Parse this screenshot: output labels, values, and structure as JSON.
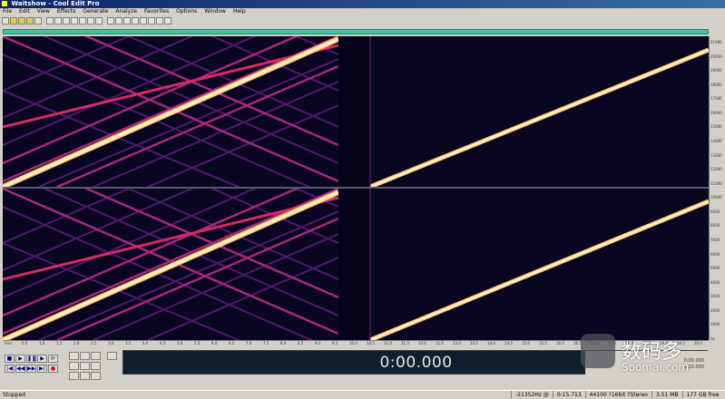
{
  "window": {
    "title": "Waitshow - Cool Edit Pro"
  },
  "menu": {
    "items": [
      "File",
      "Edit",
      "View",
      "Effects",
      "Generate",
      "Analyze",
      "Favorites",
      "Options",
      "Window",
      "Help"
    ]
  },
  "overview_color": "#47c0a0",
  "spectral_colors": {
    "background": "#080620",
    "hot": "#fff2c8",
    "mid": "#d42a64",
    "dim": "#5a1a7a"
  },
  "right_ruler": {
    "ticks": [
      "21000",
      "20000",
      "19000",
      "18000",
      "17000",
      "16000",
      "15000",
      "14000",
      "13000",
      "12000",
      "11000",
      "10000",
      "9000",
      "8000",
      "7000",
      "6000",
      "5000",
      "4000",
      "3000",
      "2000",
      "1000",
      "hz"
    ]
  },
  "bottom_ruler": {
    "ticks": [
      "hms",
      "0.5",
      "1.0",
      "1.5",
      "2.0",
      "2.5",
      "3.0",
      "3.5",
      "4.0",
      "4.5",
      "5.0",
      "5.5",
      "6.0",
      "6.5",
      "7.0",
      "7.5",
      "8.0",
      "8.5",
      "9.0",
      "9.5",
      "10.0",
      "10.5",
      "11.0",
      "11.5",
      "12.0",
      "12.5",
      "13.0",
      "13.5",
      "14.0",
      "14.5",
      "15.0",
      "15.5",
      "16.0",
      "16.5",
      "17.0",
      "17.5",
      "18.0",
      "18.5",
      "19.0",
      "19.5",
      "20.0"
    ]
  },
  "transport": {
    "stop": "■",
    "play": "▶",
    "pause": "❚❚",
    "play_looped": "▶",
    "loop": "⟳",
    "to_start": "|◀",
    "rewind": "◀◀",
    "forward": "▶▶",
    "to_end": "▶|",
    "record": "●"
  },
  "zoom_icons": [
    "zoom-in-horizontal",
    "zoom-out-horizontal",
    "zoom-full",
    "zoom-in-vertical",
    "zoom-out-vertical",
    "zoom-selection"
  ],
  "time_display": "0:00.000",
  "sel_view": {
    "begin": "0:00.000",
    "end": "0:20.000",
    "length": "0:20.000"
  },
  "watermark": {
    "cn": "数码多",
    "en": "Soomal.com"
  },
  "status": {
    "state": "Stopped",
    "cells": [
      "-21352Hz @",
      "0:15.713",
      "44100 ?16bit ?Stereo",
      "3.51 MB",
      "177 GB free"
    ]
  }
}
